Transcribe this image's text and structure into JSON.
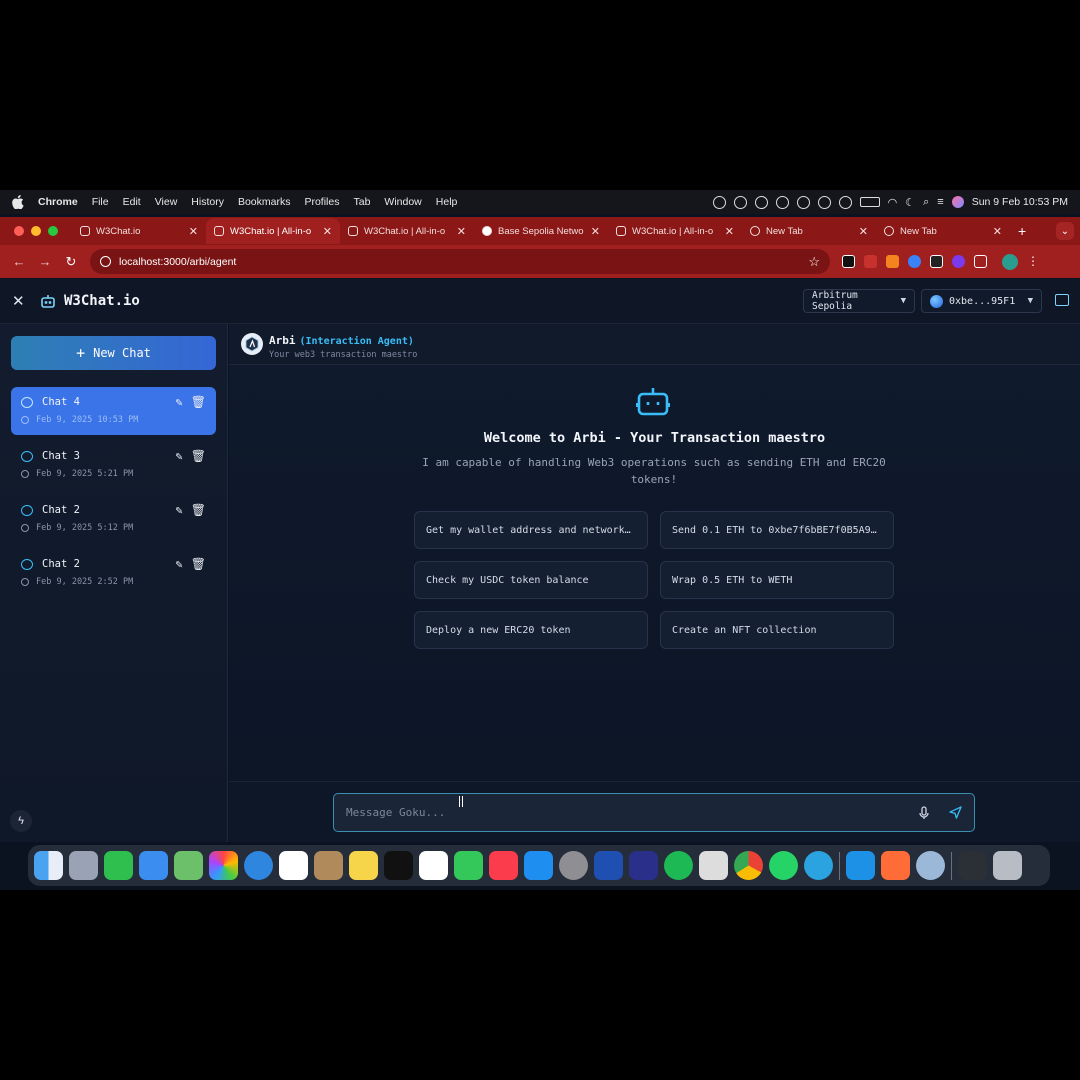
{
  "menubar": {
    "app": "Chrome",
    "items": [
      "File",
      "Edit",
      "View",
      "History",
      "Bookmarks",
      "Profiles",
      "Tab",
      "Window",
      "Help"
    ],
    "clock": "Sun 9 Feb  10:53 PM"
  },
  "tabs": [
    {
      "title": "W3Chat.io",
      "active": false
    },
    {
      "title": "W3Chat.io | All-in-o",
      "active": true
    },
    {
      "title": "W3Chat.io | All-in-o",
      "active": false
    },
    {
      "title": "Base Sepolia Netwo",
      "active": false
    },
    {
      "title": "W3Chat.io | All-in-o",
      "active": false
    },
    {
      "title": "New Tab",
      "active": false
    },
    {
      "title": "New Tab",
      "active": false
    }
  ],
  "address": {
    "url": "localhost:3000/arbi/agent"
  },
  "app": {
    "brand": "W3Chat.io",
    "network": "Arbitrum Sepolia",
    "wallet": "0xbe...95F1"
  },
  "sidebar": {
    "new_chat": "New Chat",
    "chats": [
      {
        "title": "Chat 4",
        "date": "Feb 9, 2025 10:53 PM",
        "active": true
      },
      {
        "title": "Chat 3",
        "date": "Feb 9, 2025 5:21 PM",
        "active": false
      },
      {
        "title": "Chat 2",
        "date": "Feb 9, 2025 5:12 PM",
        "active": false
      },
      {
        "title": "Chat 2",
        "date": "Feb 9, 2025 2:52 PM",
        "active": false
      }
    ]
  },
  "agent": {
    "name": "Arbi",
    "role": "(Interaction Agent)",
    "subtitle": "Your web3 transaction maestro"
  },
  "welcome": {
    "title": "Welcome to Arbi - Your Transaction maestro",
    "description": "I am capable of handling Web3 operations such as sending ETH and ERC20 tokens!"
  },
  "suggestions": [
    "Get my wallet address and network…",
    "Send 0.1 ETH to 0xbe7f6bBE7f0B5A9…",
    "Check my USDC token balance",
    "Wrap 0.5 ETH to WETH",
    "Deploy a new ERC20 token",
    "Create an NFT collection"
  ],
  "composer": {
    "placeholder": "Message Goku..."
  },
  "colors": {
    "tab_bar": "#8b1717",
    "accent": "#38bdf8",
    "active_chat": "#3b74e8",
    "background": "#0b1220"
  }
}
